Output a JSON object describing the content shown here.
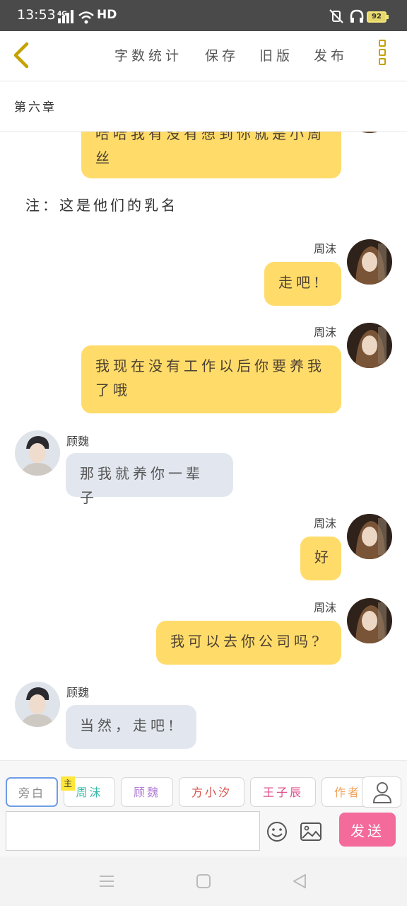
{
  "status_bar": {
    "time": "13:53",
    "network": "4G",
    "hd": "HD",
    "battery": "92"
  },
  "toolbar": {
    "word_count": "字数统计",
    "save": "保存",
    "old_version": "旧版",
    "publish": "发布"
  },
  "chapter": "第六章",
  "chat": {
    "top_partial_bubble": "哈哈我有没有想到你就是小周丝",
    "narration": "注：这是他们的乳名",
    "messages": [
      {
        "speaker": "周沫",
        "text": "走吧!"
      },
      {
        "speaker": "周沫",
        "text": "我现在没有工作以后你要养我了哦"
      },
      {
        "speaker": "顾魏",
        "text": "那我就养你一辈子"
      },
      {
        "speaker": "周沫",
        "text": "好"
      },
      {
        "speaker": "周沫",
        "text": "我可以去你公司吗?"
      },
      {
        "speaker": "顾魏",
        "text": "当然，走吧!"
      }
    ]
  },
  "roles": {
    "main_tag": "主",
    "items": [
      {
        "label": "旁白",
        "color": "#888888"
      },
      {
        "label": "周沫",
        "color": "#3bb9a8"
      },
      {
        "label": "顾魏",
        "color": "#b27fd6"
      },
      {
        "label": "方小汐",
        "color": "#d9534f"
      },
      {
        "label": "王子辰",
        "color": "#e0508c"
      },
      {
        "label": "作者",
        "color": "#f0a35a"
      }
    ]
  },
  "composer": {
    "input_value": "",
    "send_label": "发送"
  },
  "colors": {
    "right_bubble": "#ffdc6a",
    "left_bubble": "#e2e7ef",
    "accent": "#c4a200",
    "send": "#f46a9b"
  }
}
